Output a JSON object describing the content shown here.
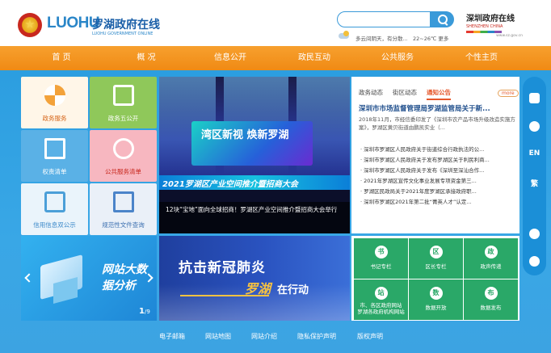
{
  "header": {
    "logo_en": "LUOHU",
    "logo_cn": "罗湖政府在线",
    "logo_sub": "LUOHU GOVERNMENT ONLINE",
    "weather": "多云间阴天，有分散...",
    "temp": "22~26℃",
    "temp_link": "更多",
    "sz_logo_cn": "深圳政府在线",
    "sz_logo_en": "SHENZHEN CHINA",
    "sz_logo_url": "www.sz.gov.cn"
  },
  "nav": [
    "首 页",
    "概 况",
    "信息公开",
    "政民互动",
    "公共服务",
    "个性主页"
  ],
  "tiles": [
    {
      "label": "政务服务",
      "icon": "pinwheel-icon"
    },
    {
      "label": "政务五公开",
      "icon": "document-icon"
    },
    {
      "label": "权责清单",
      "icon": "book-icon"
    },
    {
      "label": "公共服务清单",
      "icon": "service-list-icon"
    },
    {
      "label": "信用信息双公示",
      "icon": "credit-icon"
    },
    {
      "label": "规范性文件查询",
      "icon": "file-search-icon"
    }
  ],
  "banner": {
    "screen_text": "湾区新视 焕新罗湖",
    "led_text": "2021罗湖区产业空间推介暨招商大会",
    "caption": "12块“宝地”面向全球招商！罗湖区产业空间推介暨招商大会举行"
  },
  "news": {
    "tabs": [
      "政务动态",
      "街区动态",
      "通知公告"
    ],
    "active_tab": "通知公告",
    "more": "more",
    "headline": "深圳市市场监督管理局罗湖监管局关于新...",
    "summary": "2018年11月，市经信委印发了《深圳市农产品市场升级改造实施方案》，罗湖区黄贝街道由鹏凯实业（...",
    "items": [
      "深圳市罗湖区人民政府关于街道综合行政执法的公...",
      "深圳市罗湖区人民政府关于发布罗湖区关于利民利商...",
      "深圳市罗湖区人民政府关于发布《深圳至深汕合作...",
      "2021年罗湖区宣传文化事业发展专项资金第三...",
      "罗湖区民政局关于2021年度罗湖区承接政府职...",
      "深圳市罗湖区2021年第二批“菁英人才”认定..."
    ]
  },
  "sidebar": {
    "items": [
      {
        "icon": "robot-icon"
      },
      {
        "icon": "chat-icon"
      },
      {
        "label": "EN"
      },
      {
        "label": "繁"
      },
      {
        "icon": "accessibility-icon"
      },
      {
        "icon": "share-icon"
      }
    ]
  },
  "bigdata": {
    "title": "网站大数据分析",
    "page_current": "1",
    "page_total": "/9"
  },
  "covid": {
    "line1": "抗击新冠肺炎",
    "line2": "罗湖",
    "line3": "在行动"
  },
  "grid": [
    {
      "label": "书记专栏",
      "icon": "书"
    },
    {
      "label": "区长专栏",
      "icon": "区"
    },
    {
      "label": "政声传递",
      "icon": "政"
    },
    {
      "label": "市、各区政府网站\n罗湖各政府机构网站",
      "icon": "站"
    },
    {
      "label": "数据开放",
      "icon": "数"
    },
    {
      "label": "数据发布",
      "icon": "布"
    }
  ],
  "footer": [
    "电子邮箱",
    "网站地图",
    "网站介绍",
    "隐私保护声明",
    "版权声明"
  ]
}
